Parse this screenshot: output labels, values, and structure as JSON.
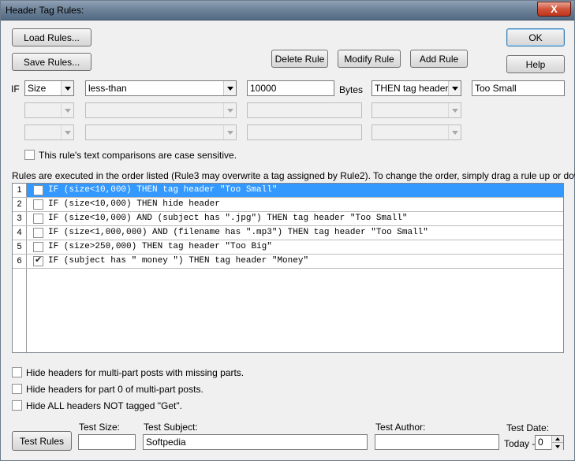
{
  "window": {
    "title": "Header Tag Rules:",
    "close_label": "X"
  },
  "buttons": {
    "load_rules": "Load Rules...",
    "save_rules": "Save Rules...",
    "delete_rule": "Delete Rule",
    "modify_rule": "Modify Rule",
    "add_rule": "Add Rule",
    "ok": "OK",
    "help": "Help",
    "test_rules": "Test Rules"
  },
  "rule_editor": {
    "if_label": "IF",
    "field": "Size",
    "operator": "less-than",
    "value": "10000",
    "units_label": "Bytes",
    "action": "THEN tag header",
    "tag": "Too Small",
    "case_sensitive_label": "This rule's text comparisons are case sensitive.",
    "case_sensitive_checked": false
  },
  "rules_info": "Rules are executed in the order listed (Rule3 may overwrite a tag assigned by Rule2).  To change the order, simply drag a rule up or down.",
  "rules": [
    {
      "num": "1",
      "text": "IF (size<10,000) THEN tag header \"Too Small\"",
      "checked": false,
      "selected": true
    },
    {
      "num": "2",
      "text": "IF (size<10,000) THEN hide header",
      "checked": false,
      "selected": false
    },
    {
      "num": "3",
      "text": "IF (size<10,000) AND (subject has \".jpg\") THEN tag header \"Too Small\"",
      "checked": false,
      "selected": false
    },
    {
      "num": "4",
      "text": "IF (size<1,000,000) AND (filename has \".mp3\") THEN tag header \"Too Small\"",
      "checked": false,
      "selected": false
    },
    {
      "num": "5",
      "text": "IF (size>250,000) THEN tag header \"Too Big\"",
      "checked": false,
      "selected": false
    },
    {
      "num": "6",
      "text": "IF (subject has \" money \") THEN tag header \"Money\"",
      "checked": true,
      "selected": false
    }
  ],
  "options": {
    "hide_missing_parts": "Hide headers for multi-part posts with missing parts.",
    "hide_part_zero": "Hide headers for part 0 of multi-part posts.",
    "hide_not_tagged_get": "Hide ALL headers NOT tagged \"Get\"."
  },
  "test": {
    "size_label": "Test Size:",
    "size_value": "",
    "subject_label": "Test Subject:",
    "subject_value": "Softpedia",
    "author_label": "Test Author:",
    "author_value": "",
    "date_label": "Test Date:",
    "today_label": "Today -",
    "date_value": "0"
  }
}
